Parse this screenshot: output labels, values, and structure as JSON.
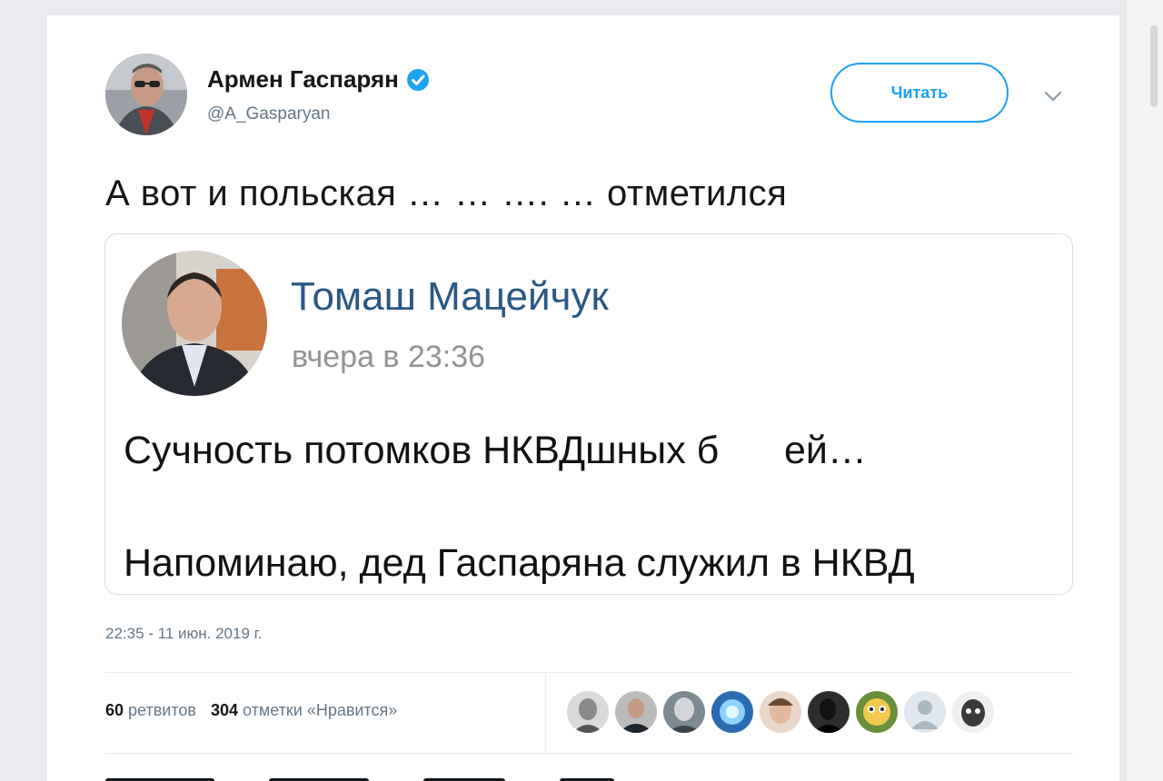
{
  "tweet": {
    "author_name": "Армен Гаспарян",
    "author_handle": "@A_Gasparyan",
    "follow_label": "Читать",
    "text": "А вот и польская … … …. … отметился",
    "timestamp": "22:35 - 11 июн. 2019 г.",
    "stats": {
      "retweets_count": "60",
      "retweets_label": "ретвитов",
      "likes_count": "304",
      "likes_label": "отметки «Нравится»"
    },
    "liker_avatar_count": 9
  },
  "embed": {
    "name": "Томаш Мацейчук",
    "time": "вчера в 23:36",
    "line1": "Сучность потомков НКВДшных б      ей…",
    "line2": "Напоминаю, дед Гаспаряна служил в НКВД"
  },
  "icons": {
    "verified": "verified-badge-icon",
    "caret": "chevron-down-icon"
  },
  "colors": {
    "accent": "#1da1f2",
    "vk_name": "#2a5885",
    "secondary_text": "#657786"
  }
}
